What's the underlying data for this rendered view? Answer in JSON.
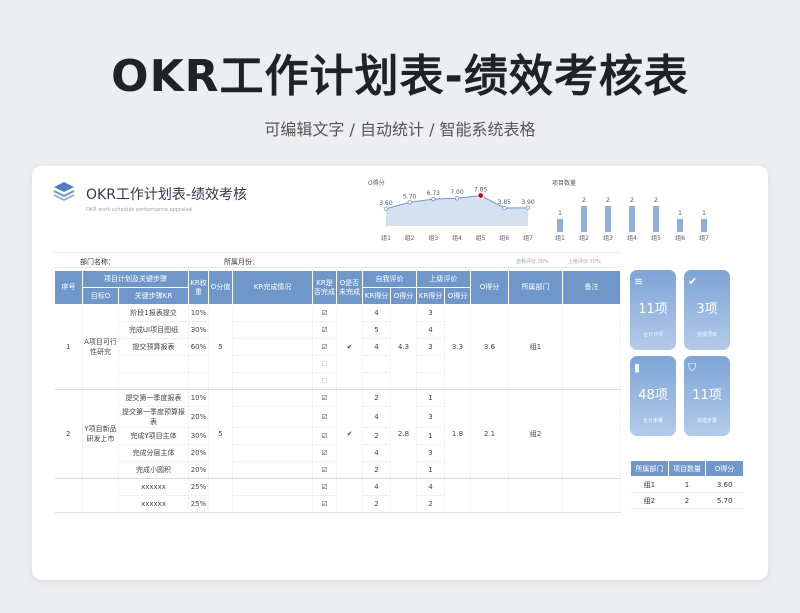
{
  "hero": {
    "title": "OKR工作计划表-绩效考核表",
    "subtitle": "可编辑文字 / 自动统计 / 智能系统表格"
  },
  "doc": {
    "title": "OKR工作计划表-绩效考核",
    "subtitle": "OKR work schedule performance appraisal"
  },
  "meta": {
    "dept_label": "部门名称：",
    "month_label": "所属月份：",
    "self_weight": "自我评价 30%",
    "boss_weight": "上级评价    70%"
  },
  "chart_data": [
    {
      "type": "area",
      "title": "O得分",
      "categories": [
        "组1",
        "组2",
        "组3",
        "组4",
        "组5",
        "组6",
        "组7"
      ],
      "values": [
        3.6,
        5.7,
        6.73,
        7.0,
        7.85,
        3.85,
        3.9
      ],
      "value_labels": [
        "3.60",
        "5.70",
        "6.73",
        "7.00",
        "7.85",
        "3.85",
        "3.90"
      ],
      "highlight_index": 4,
      "colors": {
        "line": "#6f97c9",
        "fill": "#c9d9ee",
        "highlight": "#d0021b"
      }
    },
    {
      "type": "bar",
      "title": "项目数量",
      "categories": [
        "组1",
        "组2",
        "组3",
        "组4",
        "组5",
        "组6",
        "组7"
      ],
      "values": [
        1,
        2,
        2,
        2,
        2,
        1,
        1
      ],
      "value_labels": [
        "1",
        "2",
        "2",
        "2",
        "2",
        "1",
        "1"
      ],
      "ylim": [
        0,
        2
      ],
      "colors": {
        "bar": "#8fb0da"
      }
    }
  ],
  "table": {
    "headers": {
      "seq": "序号",
      "plan": "项目计划及关键步骤",
      "kr_weight": "KR权重",
      "o_score": "O分值",
      "kr_status": "KR完成情况",
      "kr_done": "KR是否完成",
      "o_done": "O是否未完成",
      "self_eval": "自我评价",
      "boss_eval": "上级评价",
      "o_total": "O得分",
      "dept": "所属部门",
      "note": "备注",
      "goal_o": "目标O",
      "key_kr": "关键步骤KR",
      "kr_score": "KR得分",
      "o_score_sub": "O得分"
    },
    "groups": [
      {
        "seq": "1",
        "goal": "A项目可行性研究",
        "o_value": "5",
        "o_check": "✔",
        "self_o": "4.3",
        "boss_o": "3.3",
        "o_total": "3.6",
        "dept": "组1",
        "rows": [
          {
            "kr": "阶段1报表提交",
            "weight": "10%",
            "kr_check": "☑",
            "self": "4",
            "boss": "3"
          },
          {
            "kr": "完成UI项目图纸",
            "weight": "30%",
            "kr_check": "☑",
            "self": "5",
            "boss": "4"
          },
          {
            "kr": "提交预算报表",
            "weight": "60%",
            "kr_check": "☑",
            "self": "4",
            "boss": "3"
          },
          {
            "kr": "",
            "weight": "",
            "kr_check": "☐",
            "self": "",
            "boss": ""
          },
          {
            "kr": "",
            "weight": "",
            "kr_check": "☐",
            "self": "",
            "boss": ""
          }
        ]
      },
      {
        "seq": "2",
        "goal": "Y项目新品研发上市",
        "o_value": "5",
        "o_check": "✔",
        "self_o": "2.8",
        "boss_o": "1.8",
        "o_total": "2.1",
        "dept": "组2",
        "rows": [
          {
            "kr": "提交第一季度报表",
            "weight": "10%",
            "kr_check": "☑",
            "self": "2",
            "boss": "1"
          },
          {
            "kr": "提交第一季度预算报表",
            "weight": "20%",
            "kr_check": "☑",
            "self": "4",
            "boss": "3"
          },
          {
            "kr": "完成Y项目主体",
            "weight": "30%",
            "kr_check": "☑",
            "self": "2",
            "boss": "1"
          },
          {
            "kr": "完成分层主体",
            "weight": "20%",
            "kr_check": "☑",
            "self": "4",
            "boss": "3"
          },
          {
            "kr": "完成小圆积",
            "weight": "20%",
            "kr_check": "☑",
            "self": "2",
            "boss": "1"
          }
        ]
      },
      {
        "seq": "",
        "goal": "",
        "o_value": "",
        "o_check": "",
        "self_o": "",
        "boss_o": "",
        "o_total": "",
        "dept": "",
        "rows": [
          {
            "kr": "xxxxxx",
            "weight": "25%",
            "kr_check": "☑",
            "self": "4",
            "boss": "4"
          },
          {
            "kr": "xxxxxx",
            "weight": "25%",
            "kr_check": "☑",
            "self": "2",
            "boss": "2"
          }
        ]
      }
    ]
  },
  "tiles": [
    {
      "icon": "layers-icon",
      "glyph": "≋",
      "value": "11项",
      "label": "合计计项"
    },
    {
      "icon": "check-shield-icon",
      "glyph": "✔",
      "value": "3项",
      "label": "完成项目"
    },
    {
      "icon": "bookmark-icon",
      "glyph": "▮",
      "value": "48项",
      "label": "合计步骤"
    },
    {
      "icon": "shield-icon",
      "glyph": "⛉",
      "value": "11项",
      "label": "完成步骤"
    }
  ],
  "side_table": {
    "headers": [
      "所属部门",
      "项目数量",
      "O得分"
    ],
    "rows": [
      [
        "组1",
        "1",
        "3.60"
      ],
      [
        "组2",
        "2",
        "5.70"
      ]
    ]
  }
}
